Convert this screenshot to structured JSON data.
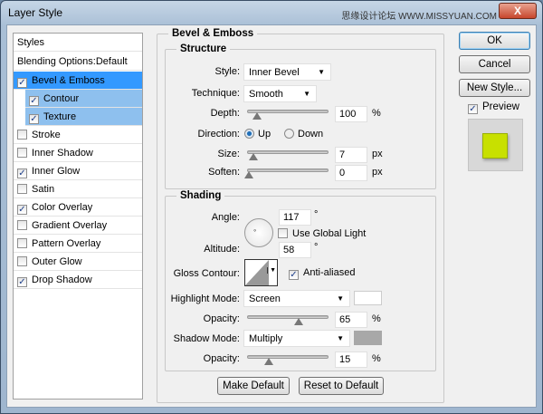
{
  "window": {
    "title": "Layer Style",
    "watermark": "思缘设计论坛 WWW.MISSYUAN.COM",
    "close": "X"
  },
  "sidebar": {
    "header": "Styles",
    "blending": "Blending Options:Default",
    "items": [
      {
        "label": "Bevel & Emboss",
        "checked": true,
        "selected": true
      },
      {
        "label": "Contour",
        "checked": true,
        "sub": true
      },
      {
        "label": "Texture",
        "checked": true,
        "sub": true
      },
      {
        "label": "Stroke",
        "checked": false
      },
      {
        "label": "Inner Shadow",
        "checked": false
      },
      {
        "label": "Inner Glow",
        "checked": true
      },
      {
        "label": "Satin",
        "checked": false
      },
      {
        "label": "Color Overlay",
        "checked": true
      },
      {
        "label": "Gradient Overlay",
        "checked": false
      },
      {
        "label": "Pattern Overlay",
        "checked": false
      },
      {
        "label": "Outer Glow",
        "checked": false
      },
      {
        "label": "Drop Shadow",
        "checked": true
      }
    ]
  },
  "main": {
    "title": "Bevel & Emboss",
    "structure": {
      "title": "Structure",
      "style_label": "Style:",
      "style": "Inner Bevel",
      "technique_label": "Technique:",
      "technique": "Smooth",
      "depth_label": "Depth:",
      "depth": "100",
      "depth_unit": "%",
      "direction_label": "Direction:",
      "up": "Up",
      "down": "Down",
      "size_label": "Size:",
      "size": "7",
      "size_unit": "px",
      "soften_label": "Soften:",
      "soften": "0",
      "soften_unit": "px"
    },
    "shading": {
      "title": "Shading",
      "angle_label": "Angle:",
      "angle": "117",
      "deg": "°",
      "global_light": "Use Global Light",
      "altitude_label": "Altitude:",
      "altitude": "58",
      "gloss_label": "Gloss Contour:",
      "anti_aliased": "Anti-aliased",
      "highlight_label": "Highlight Mode:",
      "highlight_mode": "Screen",
      "highlight_color": "#ffffff",
      "opacity_label": "Opacity:",
      "highlight_opacity": "65",
      "pct": "%",
      "shadow_label": "Shadow Mode:",
      "shadow_mode": "Multiply",
      "shadow_color": "#a8a8a8",
      "shadow_opacity": "15"
    },
    "make_default": "Make Default",
    "reset_default": "Reset to Default"
  },
  "right": {
    "ok": "OK",
    "cancel": "Cancel",
    "new_style": "New Style...",
    "preview": "Preview",
    "preview_color": "#c8e000"
  }
}
